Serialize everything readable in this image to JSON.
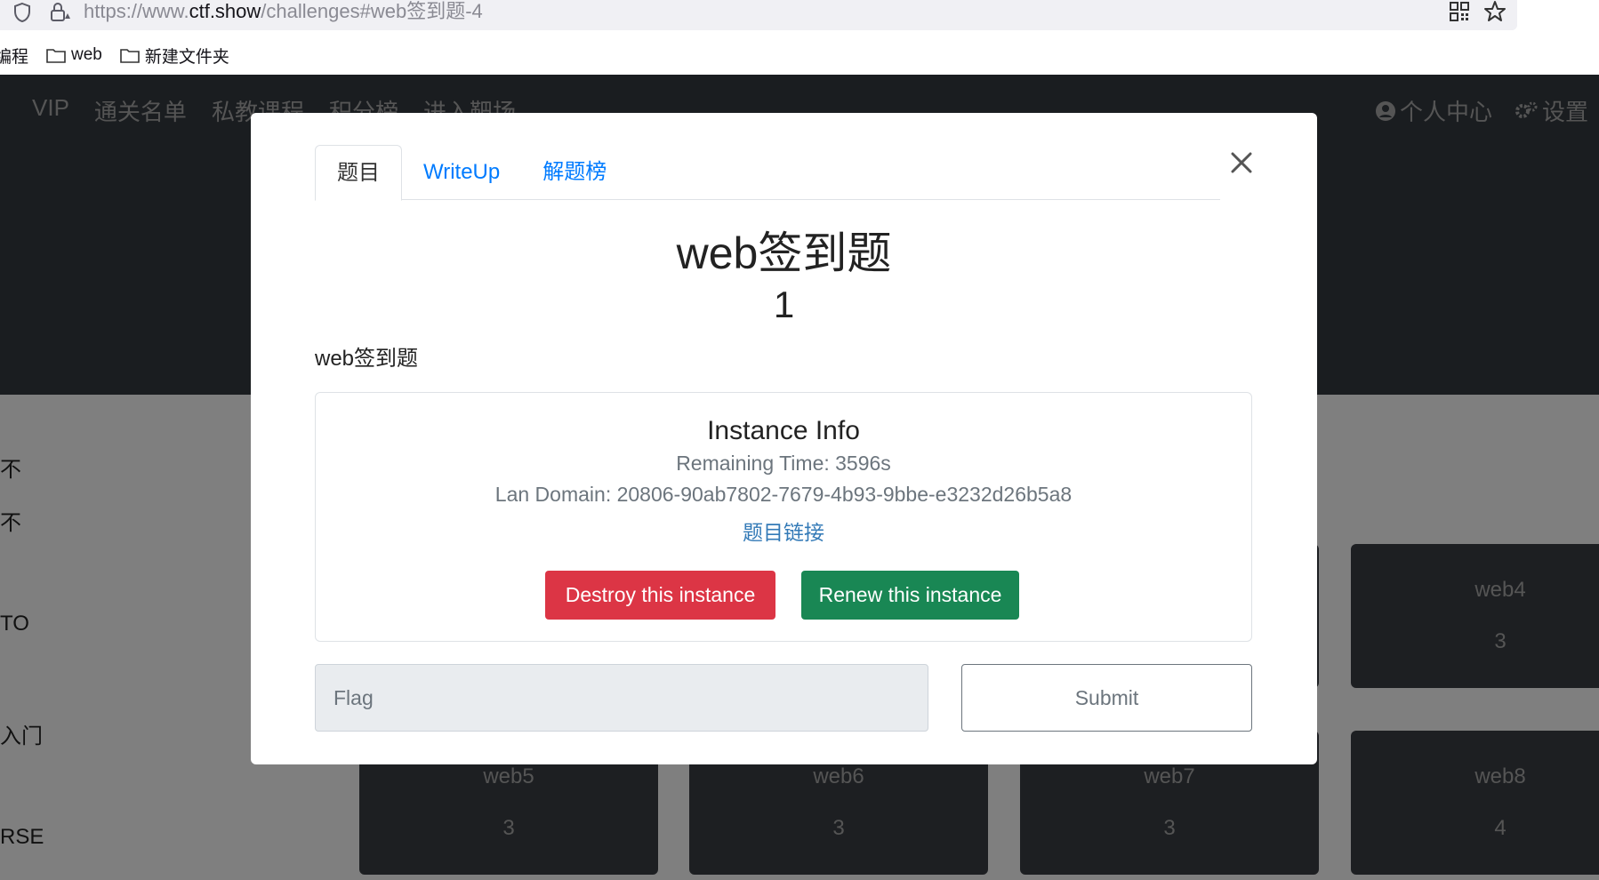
{
  "browser": {
    "url_prefix": "https://www.",
    "url_domain": "ctf.show",
    "url_path": "/challenges#web签到题-4",
    "bookmarks": [
      "编程",
      "web",
      "新建文件夹"
    ]
  },
  "background_page": {
    "nav": [
      "VIP",
      "通关名单",
      "私教课程",
      "积分榜",
      "进入靶场"
    ],
    "nav_right": [
      "个人中心",
      "设置"
    ],
    "sidebar": [
      "不",
      "不",
      "TO",
      "入门",
      "RSE"
    ],
    "cards": [
      {
        "name": "web4",
        "score": "3"
      },
      {
        "name": "web5",
        "score": "3"
      },
      {
        "name": "web6",
        "score": "3"
      },
      {
        "name": "web7",
        "score": "3"
      },
      {
        "name": "web8",
        "score": "4"
      }
    ]
  },
  "modal": {
    "tabs": [
      "题目",
      "WriteUp",
      "解题榜"
    ],
    "title": "web签到题",
    "score": "1",
    "description": "web签到题",
    "instance": {
      "heading": "Instance Info",
      "remaining_time": "Remaining Time: 3596s",
      "lan_domain": "Lan Domain: 20806-90ab7802-7679-4b93-9bbe-e3232d26b5a8",
      "link": "题目链接",
      "destroy_label": "Destroy this instance",
      "renew_label": "Renew this instance"
    },
    "flag_placeholder": "Flag",
    "submit_label": "Submit"
  },
  "colors": {
    "danger": "#dc3545",
    "success": "#198754",
    "link": "#007bff",
    "hero": "#343a40"
  }
}
